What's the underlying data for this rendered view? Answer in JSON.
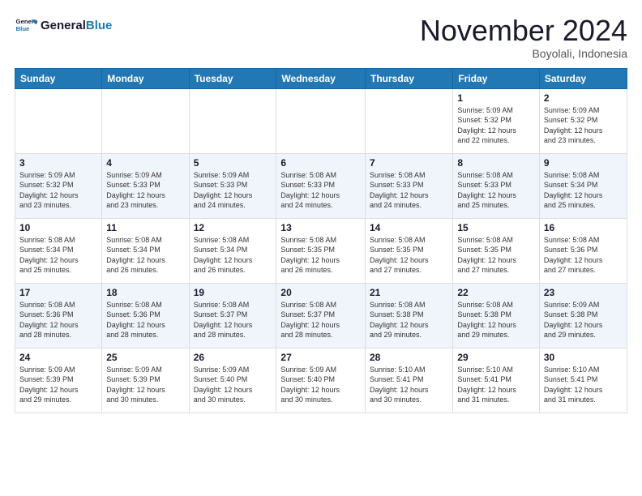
{
  "header": {
    "logo_line1": "General",
    "logo_line2": "Blue",
    "month_title": "November 2024",
    "subtitle": "Boyolali, Indonesia"
  },
  "weekdays": [
    "Sunday",
    "Monday",
    "Tuesday",
    "Wednesday",
    "Thursday",
    "Friday",
    "Saturday"
  ],
  "weeks": [
    [
      {
        "day": "",
        "info": ""
      },
      {
        "day": "",
        "info": ""
      },
      {
        "day": "",
        "info": ""
      },
      {
        "day": "",
        "info": ""
      },
      {
        "day": "",
        "info": ""
      },
      {
        "day": "1",
        "info": "Sunrise: 5:09 AM\nSunset: 5:32 PM\nDaylight: 12 hours\nand 22 minutes."
      },
      {
        "day": "2",
        "info": "Sunrise: 5:09 AM\nSunset: 5:32 PM\nDaylight: 12 hours\nand 23 minutes."
      }
    ],
    [
      {
        "day": "3",
        "info": "Sunrise: 5:09 AM\nSunset: 5:32 PM\nDaylight: 12 hours\nand 23 minutes."
      },
      {
        "day": "4",
        "info": "Sunrise: 5:09 AM\nSunset: 5:33 PM\nDaylight: 12 hours\nand 23 minutes."
      },
      {
        "day": "5",
        "info": "Sunrise: 5:09 AM\nSunset: 5:33 PM\nDaylight: 12 hours\nand 24 minutes."
      },
      {
        "day": "6",
        "info": "Sunrise: 5:08 AM\nSunset: 5:33 PM\nDaylight: 12 hours\nand 24 minutes."
      },
      {
        "day": "7",
        "info": "Sunrise: 5:08 AM\nSunset: 5:33 PM\nDaylight: 12 hours\nand 24 minutes."
      },
      {
        "day": "8",
        "info": "Sunrise: 5:08 AM\nSunset: 5:33 PM\nDaylight: 12 hours\nand 25 minutes."
      },
      {
        "day": "9",
        "info": "Sunrise: 5:08 AM\nSunset: 5:34 PM\nDaylight: 12 hours\nand 25 minutes."
      }
    ],
    [
      {
        "day": "10",
        "info": "Sunrise: 5:08 AM\nSunset: 5:34 PM\nDaylight: 12 hours\nand 25 minutes."
      },
      {
        "day": "11",
        "info": "Sunrise: 5:08 AM\nSunset: 5:34 PM\nDaylight: 12 hours\nand 26 minutes."
      },
      {
        "day": "12",
        "info": "Sunrise: 5:08 AM\nSunset: 5:34 PM\nDaylight: 12 hours\nand 26 minutes."
      },
      {
        "day": "13",
        "info": "Sunrise: 5:08 AM\nSunset: 5:35 PM\nDaylight: 12 hours\nand 26 minutes."
      },
      {
        "day": "14",
        "info": "Sunrise: 5:08 AM\nSunset: 5:35 PM\nDaylight: 12 hours\nand 27 minutes."
      },
      {
        "day": "15",
        "info": "Sunrise: 5:08 AM\nSunset: 5:35 PM\nDaylight: 12 hours\nand 27 minutes."
      },
      {
        "day": "16",
        "info": "Sunrise: 5:08 AM\nSunset: 5:36 PM\nDaylight: 12 hours\nand 27 minutes."
      }
    ],
    [
      {
        "day": "17",
        "info": "Sunrise: 5:08 AM\nSunset: 5:36 PM\nDaylight: 12 hours\nand 28 minutes."
      },
      {
        "day": "18",
        "info": "Sunrise: 5:08 AM\nSunset: 5:36 PM\nDaylight: 12 hours\nand 28 minutes."
      },
      {
        "day": "19",
        "info": "Sunrise: 5:08 AM\nSunset: 5:37 PM\nDaylight: 12 hours\nand 28 minutes."
      },
      {
        "day": "20",
        "info": "Sunrise: 5:08 AM\nSunset: 5:37 PM\nDaylight: 12 hours\nand 28 minutes."
      },
      {
        "day": "21",
        "info": "Sunrise: 5:08 AM\nSunset: 5:38 PM\nDaylight: 12 hours\nand 29 minutes."
      },
      {
        "day": "22",
        "info": "Sunrise: 5:08 AM\nSunset: 5:38 PM\nDaylight: 12 hours\nand 29 minutes."
      },
      {
        "day": "23",
        "info": "Sunrise: 5:09 AM\nSunset: 5:38 PM\nDaylight: 12 hours\nand 29 minutes."
      }
    ],
    [
      {
        "day": "24",
        "info": "Sunrise: 5:09 AM\nSunset: 5:39 PM\nDaylight: 12 hours\nand 29 minutes."
      },
      {
        "day": "25",
        "info": "Sunrise: 5:09 AM\nSunset: 5:39 PM\nDaylight: 12 hours\nand 30 minutes."
      },
      {
        "day": "26",
        "info": "Sunrise: 5:09 AM\nSunset: 5:40 PM\nDaylight: 12 hours\nand 30 minutes."
      },
      {
        "day": "27",
        "info": "Sunrise: 5:09 AM\nSunset: 5:40 PM\nDaylight: 12 hours\nand 30 minutes."
      },
      {
        "day": "28",
        "info": "Sunrise: 5:10 AM\nSunset: 5:41 PM\nDaylight: 12 hours\nand 30 minutes."
      },
      {
        "day": "29",
        "info": "Sunrise: 5:10 AM\nSunset: 5:41 PM\nDaylight: 12 hours\nand 31 minutes."
      },
      {
        "day": "30",
        "info": "Sunrise: 5:10 AM\nSunset: 5:41 PM\nDaylight: 12 hours\nand 31 minutes."
      }
    ]
  ]
}
